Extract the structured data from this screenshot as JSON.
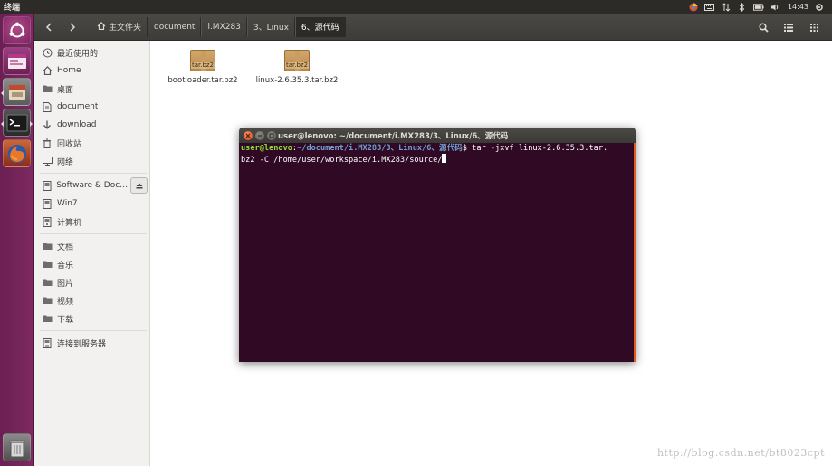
{
  "top_panel": {
    "title": "终端",
    "clock": "14:43"
  },
  "toolbar": {
    "back_icon": "chevron-left-icon",
    "forward_icon": "chevron-right-icon",
    "breadcrumbs": [
      {
        "label": "主文件夹",
        "icon": "home-icon"
      },
      {
        "label": "document"
      },
      {
        "label": "i.MX283"
      },
      {
        "label": "3、Linux"
      },
      {
        "label": "6、源代码"
      }
    ]
  },
  "sidebar": {
    "items": [
      {
        "label": "最近使用的",
        "icon": "clock-icon"
      },
      {
        "label": "Home",
        "icon": "home-icon"
      },
      {
        "label": "桌面",
        "icon": "desktop-folder-icon"
      },
      {
        "label": "document",
        "icon": "document-icon"
      },
      {
        "label": "download",
        "icon": "download-icon"
      },
      {
        "label": "回收站",
        "icon": "trash-icon"
      },
      {
        "label": "网络",
        "icon": "network-icon"
      }
    ],
    "devices": [
      {
        "label": "Software & Docu...",
        "icon": "drive-icon"
      },
      {
        "label": "Win7",
        "icon": "drive-icon"
      },
      {
        "label": "计算机",
        "icon": "computer-icon"
      }
    ],
    "bookmarks": [
      {
        "label": "文档",
        "icon": "folder-icon"
      },
      {
        "label": "音乐",
        "icon": "folder-icon"
      },
      {
        "label": "图片",
        "icon": "folder-icon"
      },
      {
        "label": "视频",
        "icon": "folder-icon"
      },
      {
        "label": "下载",
        "icon": "folder-icon"
      }
    ],
    "connect": {
      "label": "连接到服务器",
      "icon": "server-icon"
    }
  },
  "files": [
    {
      "name": "bootloader.tar.bz2",
      "badge": "tar.bz2",
      "icon": "package-icon"
    },
    {
      "name": "linux-2.6.35.3.tar.bz2",
      "badge": "tar.bz2",
      "icon": "package-icon"
    }
  ],
  "terminal": {
    "title": "user@lenovo: ~/document/i.MX283/3、Linux/6、源代码",
    "prompt_user": "user@lenovo",
    "prompt_path": "~/document/i.MX283/3、Linux/6、源代码",
    "prompt_sym": "$",
    "command_line1": " tar -jxvf linux-2.6.35.3.tar.",
    "command_line2": "bz2 -C /home/user/workspace/i.MX283/source/"
  },
  "watermark": "http://blog.csdn.net/bt8023cpt",
  "colors": {
    "terminal_bg": "#300a24",
    "prompt_user": "#8ae234",
    "prompt_path": "#729fcf",
    "launcher": "#7d2a61",
    "panel": "#2c2b28"
  }
}
